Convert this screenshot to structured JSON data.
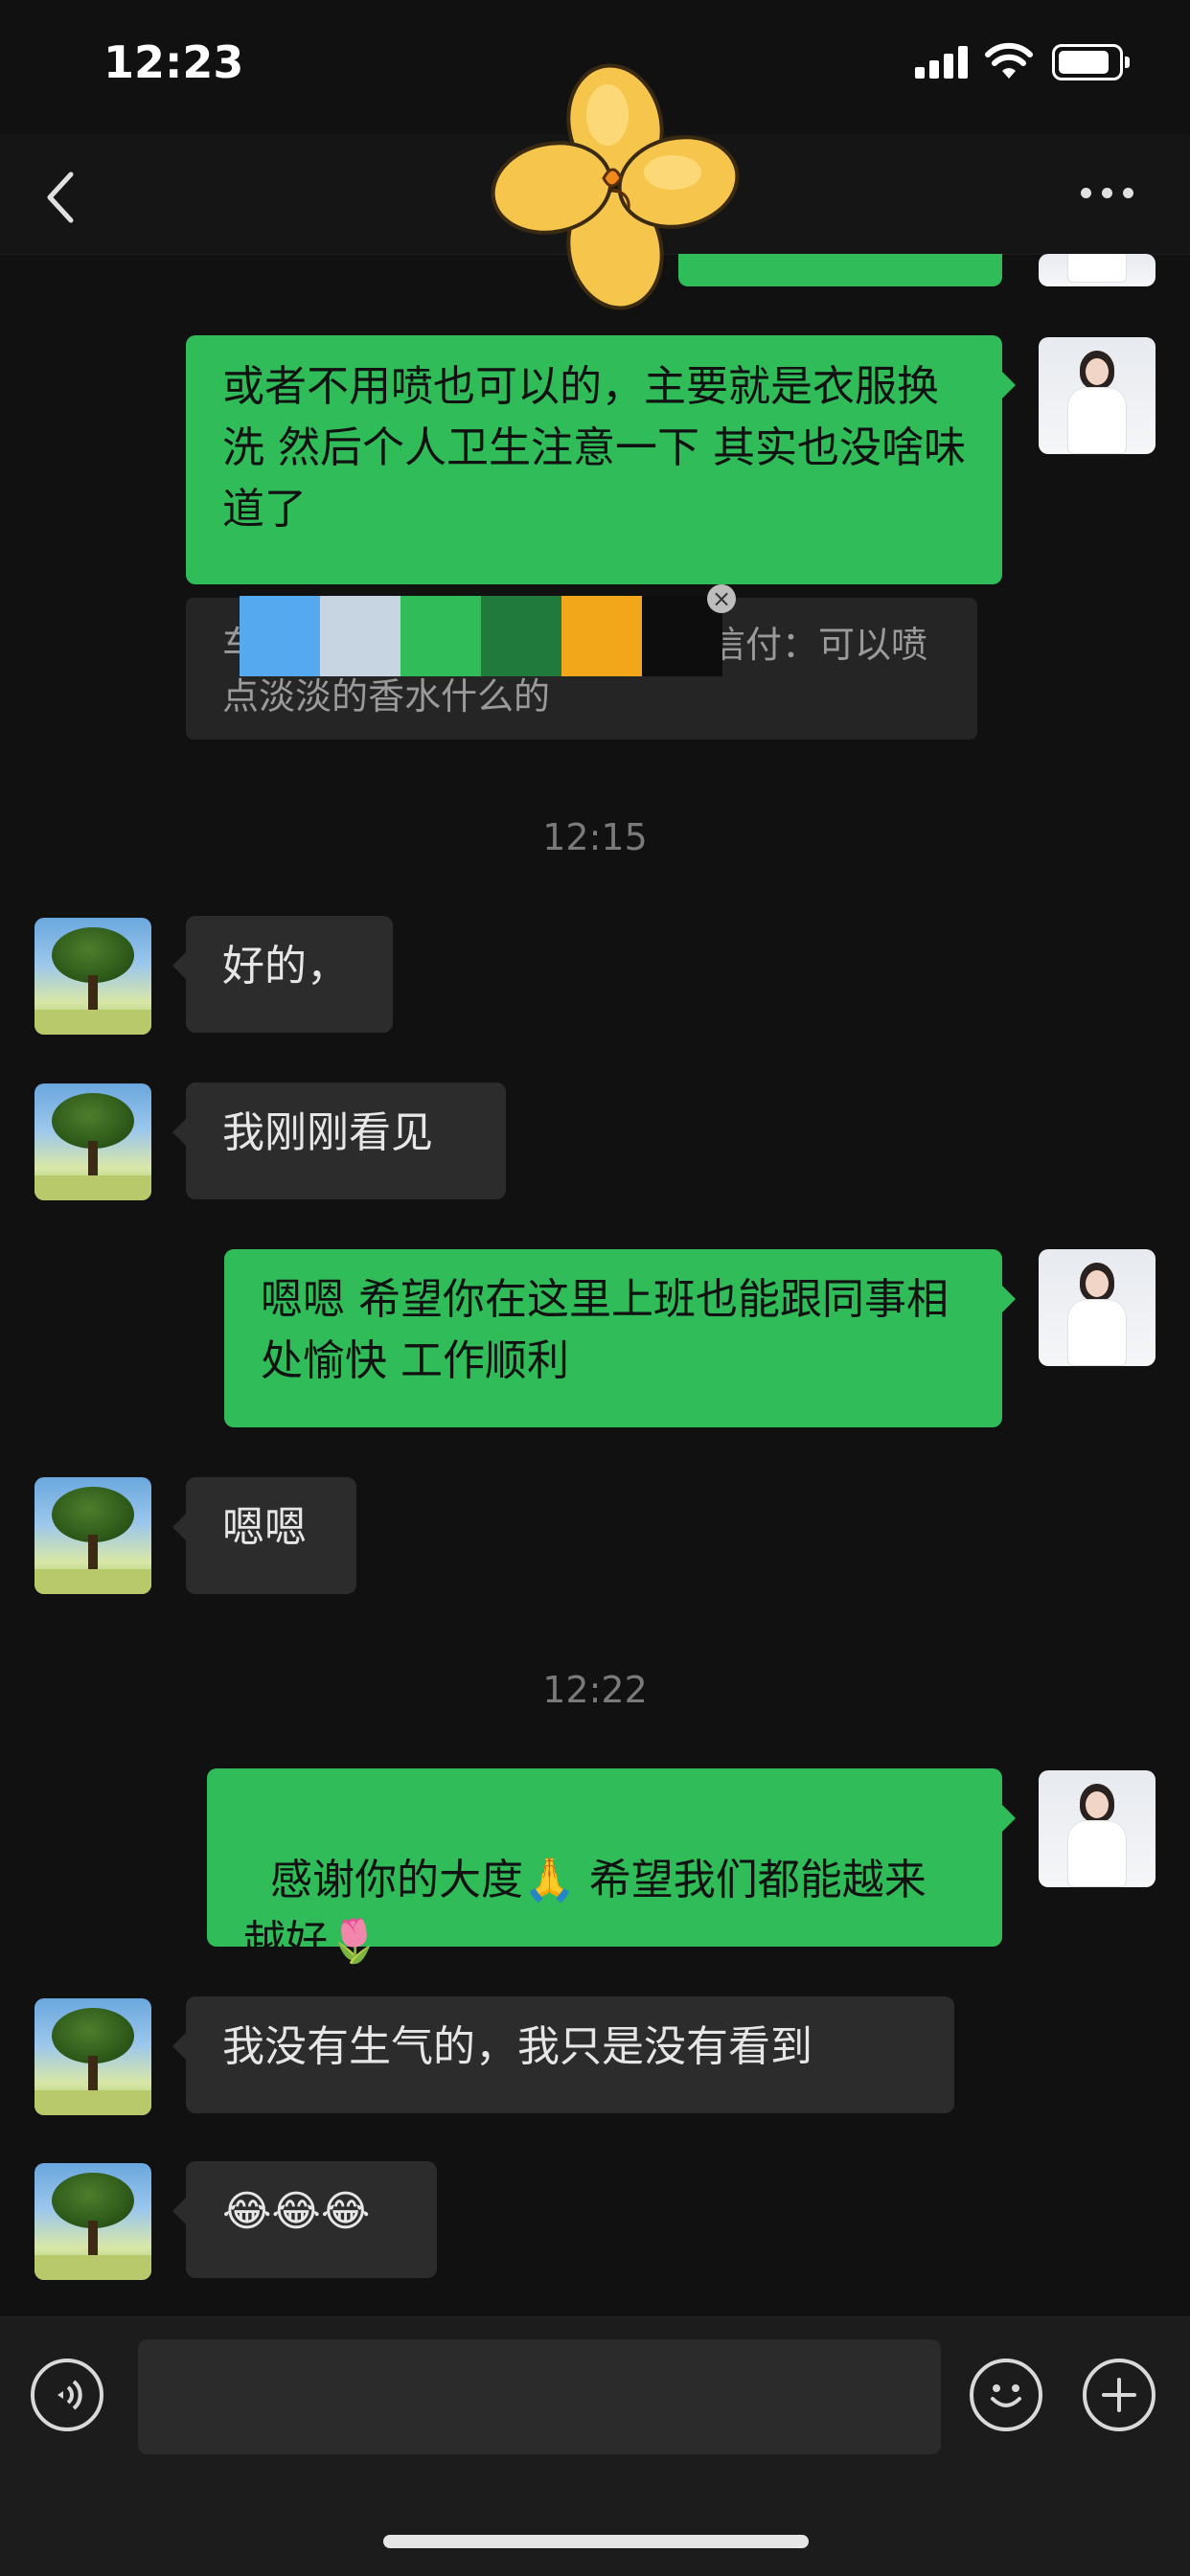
{
  "status_bar": {
    "time": "12:23"
  },
  "nav": {
    "title": ""
  },
  "sticker": {
    "kind": "yellow flower"
  },
  "color_swatches": [
    "#55a9ef",
    "#c7d5e2",
    "#2fbc59",
    "#1f7a3b",
    "#f2a71b",
    "#0d0d0d"
  ],
  "messages": {
    "m1": "或者不用喷也可以的，主要就是衣服换洗 然后个人卫生注意一下 其实也没啥味道了",
    "quote_start": "车",
    "quote_rest": "信付：可以喷",
    "quote_line2": "点淡淡的香水什么的",
    "time1": "12:15",
    "m2": "好的，",
    "m3": "我刚刚看见",
    "m4": "嗯嗯 希望你在这里上班也能跟同事相处愉快 工作顺利",
    "m5": "嗯嗯",
    "time2": "12:22",
    "m6": "感谢你的大度",
    "m6_emoji": "🙏",
    "m6_rest": " 希望我们都能越来越好",
    "m6_emoji2": "🌷",
    "m7": "我没有生气的，我只是没有看到",
    "m8": "😂😂😂"
  },
  "input": {
    "placeholder": ""
  },
  "icons": {
    "back": "chevron-left-icon",
    "more": "more-dots-icon",
    "voice": "voice-icon",
    "emoji": "emoji-icon",
    "add": "plus-icon",
    "close": "close-icon"
  },
  "colors": {
    "outgoing": "#2fbc59",
    "incoming": "#2c2c2c",
    "background": "#111111"
  }
}
